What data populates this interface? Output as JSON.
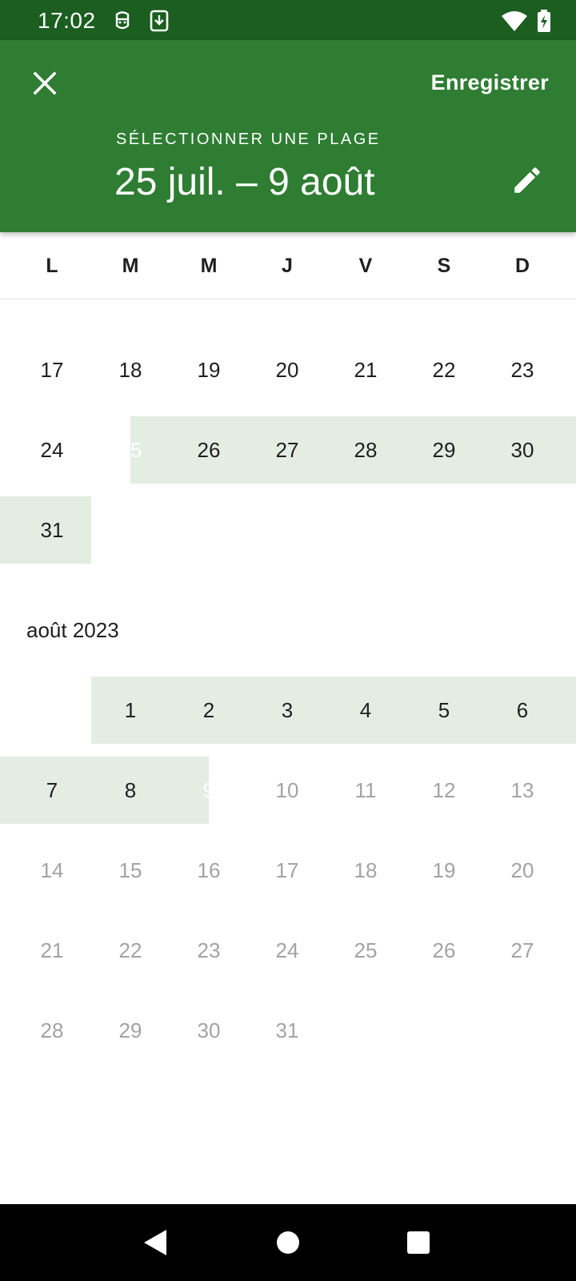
{
  "status_bar": {
    "time": "17:02",
    "icons_left": [
      "face-icon",
      "download-icon"
    ],
    "icons_right": [
      "wifi-icon",
      "battery-charging-icon"
    ]
  },
  "header": {
    "close_icon": "close-icon",
    "save_label": "Enregistrer",
    "overline": "SÉLECTIONNER UNE PLAGE",
    "range_text": "25 juil. – 9 août",
    "edit_icon": "pencil-icon",
    "background_color": "#2e7d32",
    "status_bar_color": "#1b5e20"
  },
  "weekdays": [
    "L",
    "M",
    "M",
    "J",
    "V",
    "S",
    "D"
  ],
  "july": {
    "rows": [
      [
        "17",
        "18",
        "19",
        "20",
        "21",
        "22",
        "23"
      ],
      [
        "24",
        "25",
        "26",
        "27",
        "28",
        "29",
        "30"
      ],
      [
        "31",
        "",
        "",
        "",
        "",
        "",
        ""
      ]
    ]
  },
  "august": {
    "label": "août 2023",
    "rows": [
      [
        "",
        "1",
        "2",
        "3",
        "4",
        "5",
        "6"
      ],
      [
        "7",
        "8",
        "9",
        "10",
        "11",
        "12",
        "13"
      ],
      [
        "14",
        "15",
        "16",
        "17",
        "18",
        "19",
        "20"
      ],
      [
        "21",
        "22",
        "23",
        "24",
        "25",
        "26",
        "27"
      ],
      [
        "28",
        "29",
        "30",
        "31",
        "",
        "",
        ""
      ]
    ]
  },
  "selection": {
    "start": "25 juillet",
    "end": "9 août",
    "accent_color": "#2e7d32",
    "range_color": "#e4ede4"
  },
  "nav_bar": {
    "buttons": [
      "back-icon",
      "home-icon",
      "recents-icon"
    ]
  }
}
